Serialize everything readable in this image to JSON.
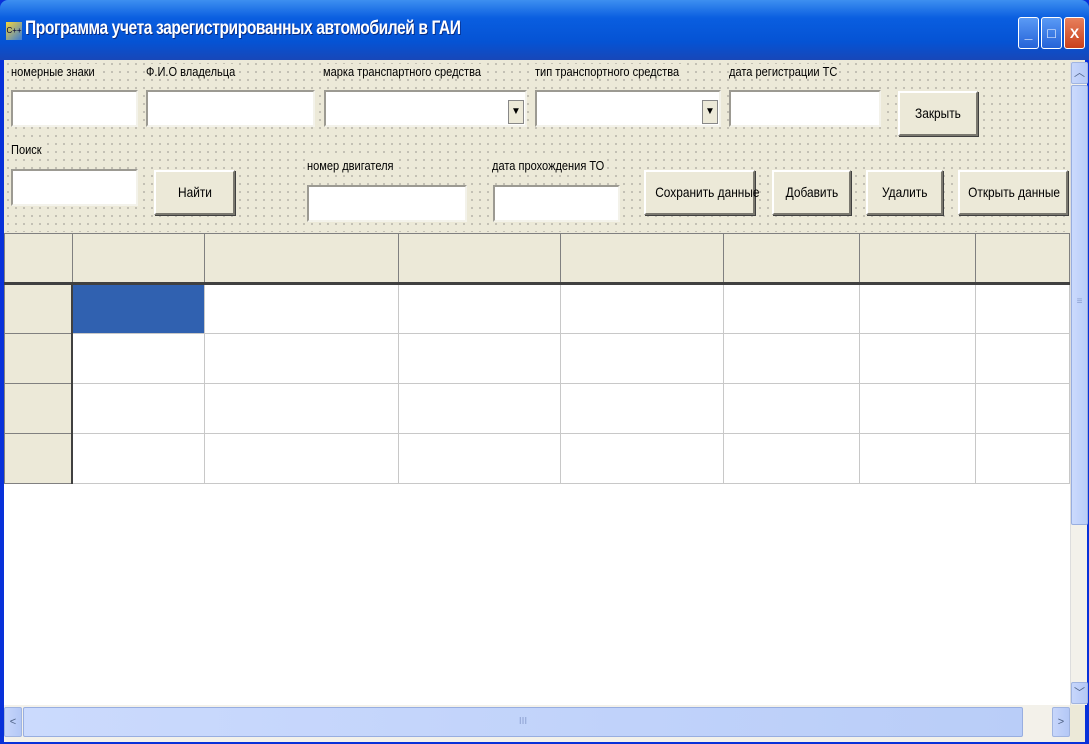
{
  "window": {
    "title": "Программа учета зарегистрированных автомобилей в ГАИ",
    "minimize": "_",
    "maximize": "□",
    "close": "X"
  },
  "form": {
    "labels": {
      "plates": "номерные знаки",
      "owner": "Ф.И.О владельца",
      "brand": "марка транспартного средства",
      "type": "тип транспортного средства",
      "reg_date": "дата регистрации ТС",
      "search": "Поиск",
      "engine": "номер двигателя",
      "inspection_date": "дата прохождения ТО"
    },
    "values": {
      "plates": "",
      "owner": "",
      "brand": "",
      "type": "",
      "reg_date": "",
      "search": "",
      "engine": "",
      "inspection_date": ""
    },
    "buttons": {
      "close": "Закрыть",
      "find": "Найти",
      "save": "Сохранить данные",
      "add": "Добавить",
      "delete": "Удалить",
      "open": "Открыть данные"
    }
  },
  "grid": {
    "columns": [
      "",
      "",
      "",
      "",
      "",
      "",
      ""
    ],
    "rows": [
      [
        "",
        "",
        "",
        "",
        "",
        "",
        ""
      ],
      [
        "",
        "",
        "",
        "",
        "",
        "",
        ""
      ],
      [
        "",
        "",
        "",
        "",
        "",
        "",
        ""
      ],
      [
        "",
        "",
        "",
        "",
        "",
        "",
        ""
      ]
    ],
    "selected": {
      "row": 0,
      "col": 0
    }
  },
  "scroll": {
    "grip": "≡",
    "hgrip": "III",
    "up": "︿",
    "down": "﹀",
    "left": "<",
    "right": ">"
  },
  "colors": {
    "selection": "#3061b0",
    "titlebar": "#0553d4"
  }
}
